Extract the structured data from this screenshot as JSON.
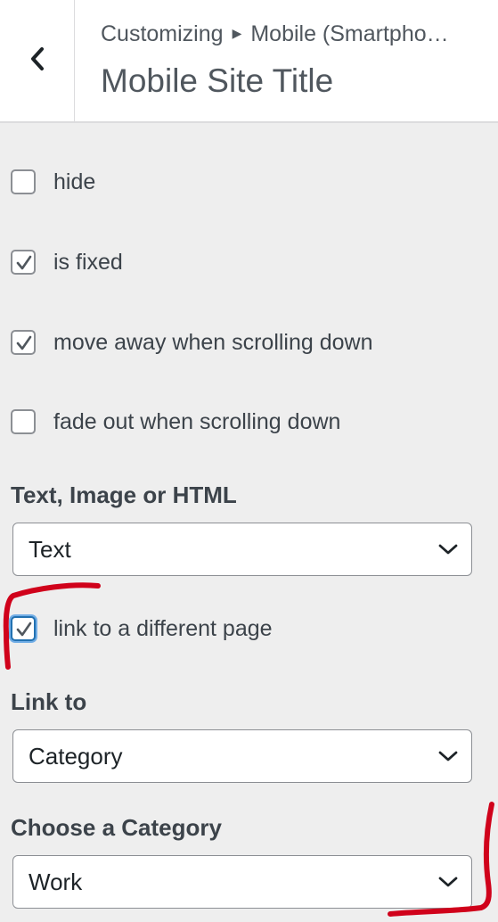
{
  "header": {
    "breadcrumb_root": "Customizing",
    "breadcrumb_section": "Mobile (Smartpho…",
    "title": "Mobile Site Title"
  },
  "options": [
    {
      "label": "hide",
      "checked": false
    },
    {
      "label": "is fixed",
      "checked": true
    },
    {
      "label": "move away when scrolling down",
      "checked": true
    },
    {
      "label": "fade out when scrolling down",
      "checked": false
    }
  ],
  "content_type": {
    "label": "Text, Image or HTML",
    "value": "Text"
  },
  "link_option": {
    "label": "link to a different page",
    "checked": true
  },
  "link_to": {
    "label": "Link to",
    "value": "Category"
  },
  "category": {
    "label": "Choose a Category",
    "value": "Work"
  },
  "colors": {
    "accent": "#2271b1",
    "annotation": "#d0021b"
  }
}
